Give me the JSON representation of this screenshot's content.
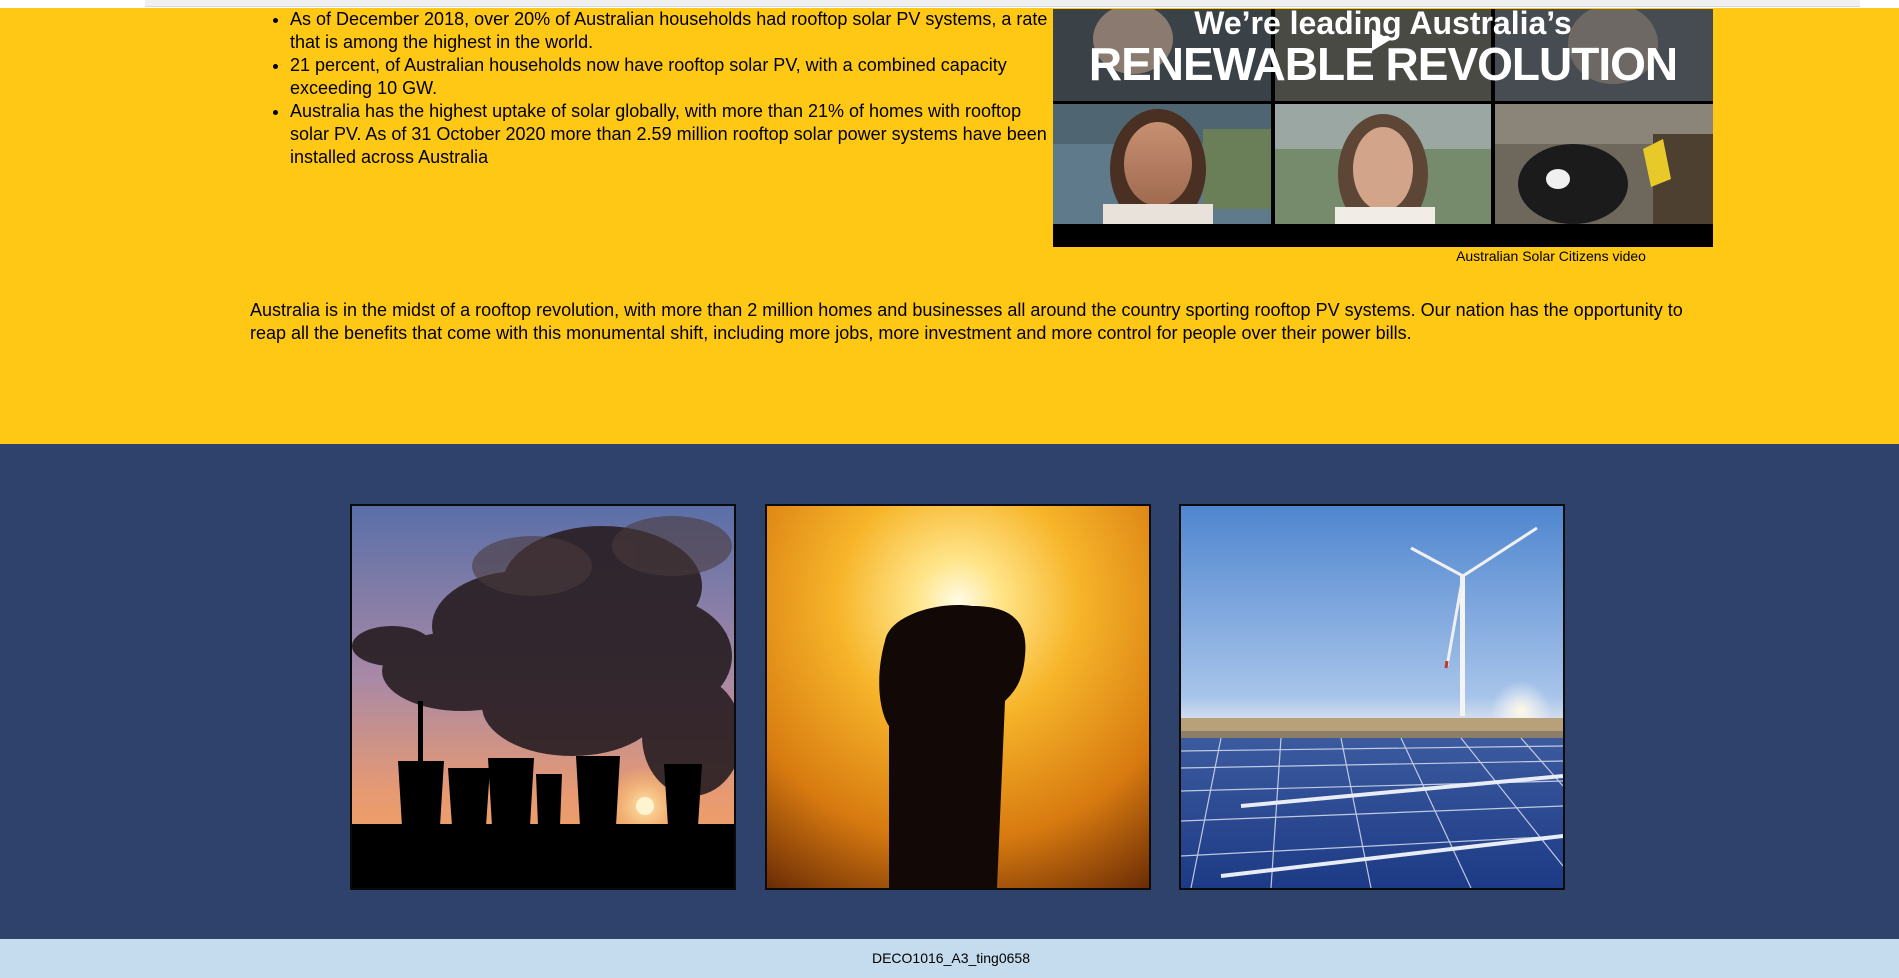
{
  "bullets": [
    "As of December 2018, over 20% of Australian households had rooftop solar PV systems, a rate that is among the highest in the world.",
    "21 percent, of Australian households now have rooftop solar PV, with a combined capacity exceeding 10 GW.",
    "Australia has the highest uptake of solar globally, with more than 21% of homes with rooftop solar PV. As of 31 October 2020 more than 2.59 million rooftop solar power systems have been installed across Australia"
  ],
  "video": {
    "title_line1": "We’re leading Australia’s",
    "title_line2": "RENEWABLE REVOLUTION",
    "caption": "Australian Solar Citizens video",
    "icon": "play-icon"
  },
  "paragraph": "Australia is in the midst of a rooftop revolution, with more than 2 million homes and businesses all around the country sporting rooftop PV systems. Our nation has the opportunity to reap all the benefits that come with this monumental shift, including more jobs, more investment and more control for people over their power bills.",
  "images": [
    {
      "subject": "power-plant-smoke-image"
    },
    {
      "subject": "raised-fist-sunset-image"
    },
    {
      "subject": "wind-turbine-solar-farm-image"
    }
  ],
  "footer": {
    "text": "DECO1016_A3_ting0658"
  },
  "colors": {
    "yellow_band": "#fec815",
    "blue_band": "#2f426b",
    "footer_band": "#c5dcee"
  }
}
